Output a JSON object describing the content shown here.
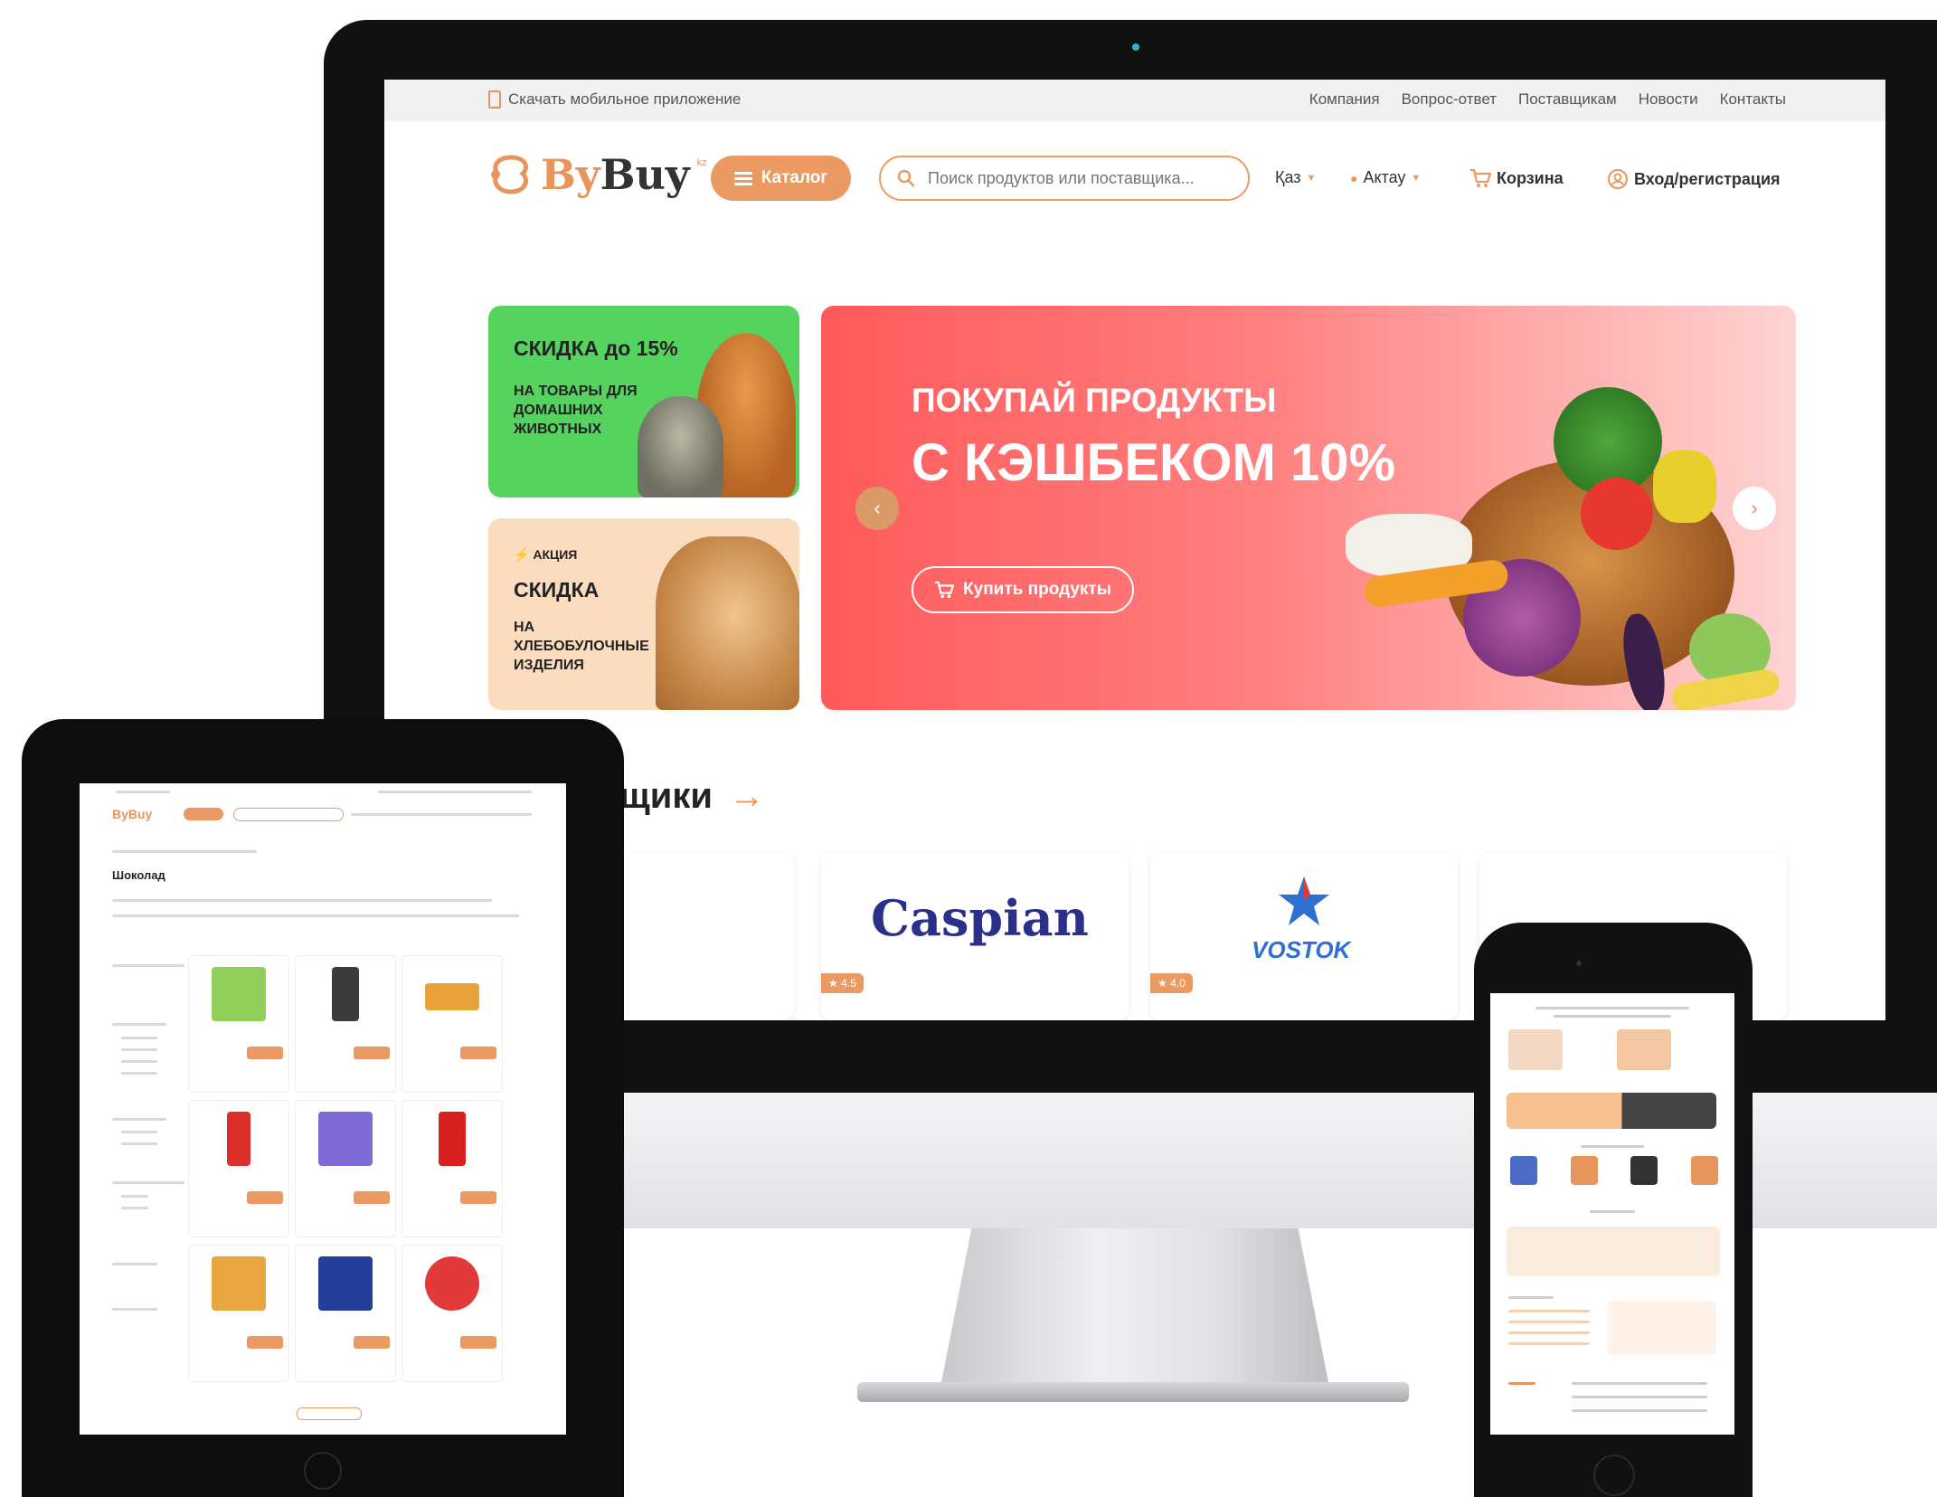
{
  "topbar": {
    "app_link": "Скачать мобильное приложение",
    "links": [
      "Компания",
      "Вопрос-ответ",
      "Поставщикам",
      "Новости",
      "Контакты"
    ]
  },
  "header": {
    "logo_by": "By",
    "logo_buy": "Buy",
    "logo_suffix": "kz",
    "catalog": "Каталог",
    "search_placeholder": "Поиск продуктов или поставщика...",
    "language": "Қаз",
    "city": "Актау",
    "cart": "Корзина",
    "login": "Вход/регистрация"
  },
  "promos": [
    {
      "title": "СКИДКА до 15%",
      "subtitle": "НА ТОВАРЫ ДЛЯ ДОМАШНИХ ЖИВОТНЫХ"
    },
    {
      "tag": "АКЦИЯ",
      "title": "СКИДКА",
      "subtitle": "НА ХЛЕБОБУЛОЧНЫЕ ИЗДЕЛИЯ"
    }
  ],
  "hero": {
    "line1": "ПОКУПАЙ ПРОДУКТЫ",
    "line2": "С КЭШБЕКОМ 10%",
    "button": "Купить продукты"
  },
  "suppliers": {
    "title_fragment": "щики",
    "cards": [
      {
        "name": "",
        "rating": ""
      },
      {
        "name": "Caspian",
        "rating": "4.5"
      },
      {
        "name": "VOSTOK",
        "rating": "4.0"
      },
      {
        "name": "",
        "rating": ""
      }
    ]
  },
  "tablet": {
    "logo": "ByBuy",
    "page_title": "Шоколад"
  },
  "colors": {
    "accent": "#ec9a63",
    "pets_bg": "#56d35f",
    "bread_bg": "#fbdcbe",
    "hero_red": "#ff5a5a"
  }
}
